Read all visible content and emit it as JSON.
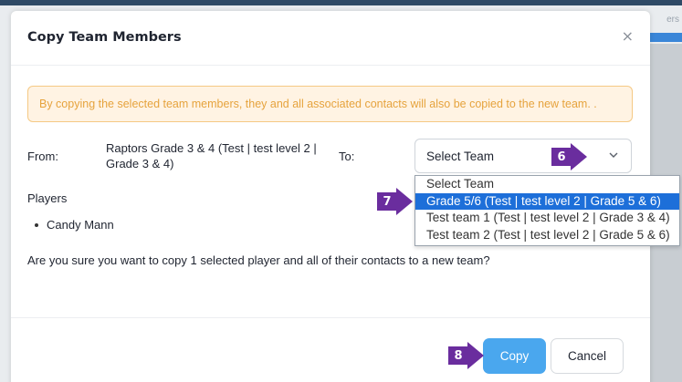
{
  "background": {
    "corner_text": "ers"
  },
  "modal": {
    "title": "Copy Team Members",
    "close_icon": "×",
    "warning": "By copying the selected team members, they and all associated contacts will also be copied to the new team. .",
    "from_label": "From:",
    "from_value": "Raptors Grade 3 & 4 (Test | test level 2 | Grade 3 & 4)",
    "to_label": "To:",
    "select": {
      "value": "Select Team",
      "options": [
        "Select Team",
        "Grade 5/6 (Test | test level 2 | Grade 5 & 6)",
        "Test team 1 (Test | test level 2 | Grade 3 & 4)",
        "Test team 2 (Test | test level 2 | Grade 5 & 6)"
      ],
      "highlighted_option": "Grade 5/6 (Test | test level 2 | Grade 5 & 6)"
    },
    "players_label": "Players",
    "players": [
      "Candy Mann"
    ],
    "confirm_text": "Are you sure you want to copy 1 selected player and all of their contacts to a new team?",
    "copy_label": "Copy",
    "cancel_label": "Cancel"
  },
  "callouts": [
    "6",
    "7",
    "8"
  ],
  "colors": {
    "accent": "#4aa7ee",
    "warning_text": "#e6a33d",
    "warning_bg": "#fff3e3",
    "callout": "#6a2d9e",
    "dropdown_highlight": "#1d6fd9"
  }
}
